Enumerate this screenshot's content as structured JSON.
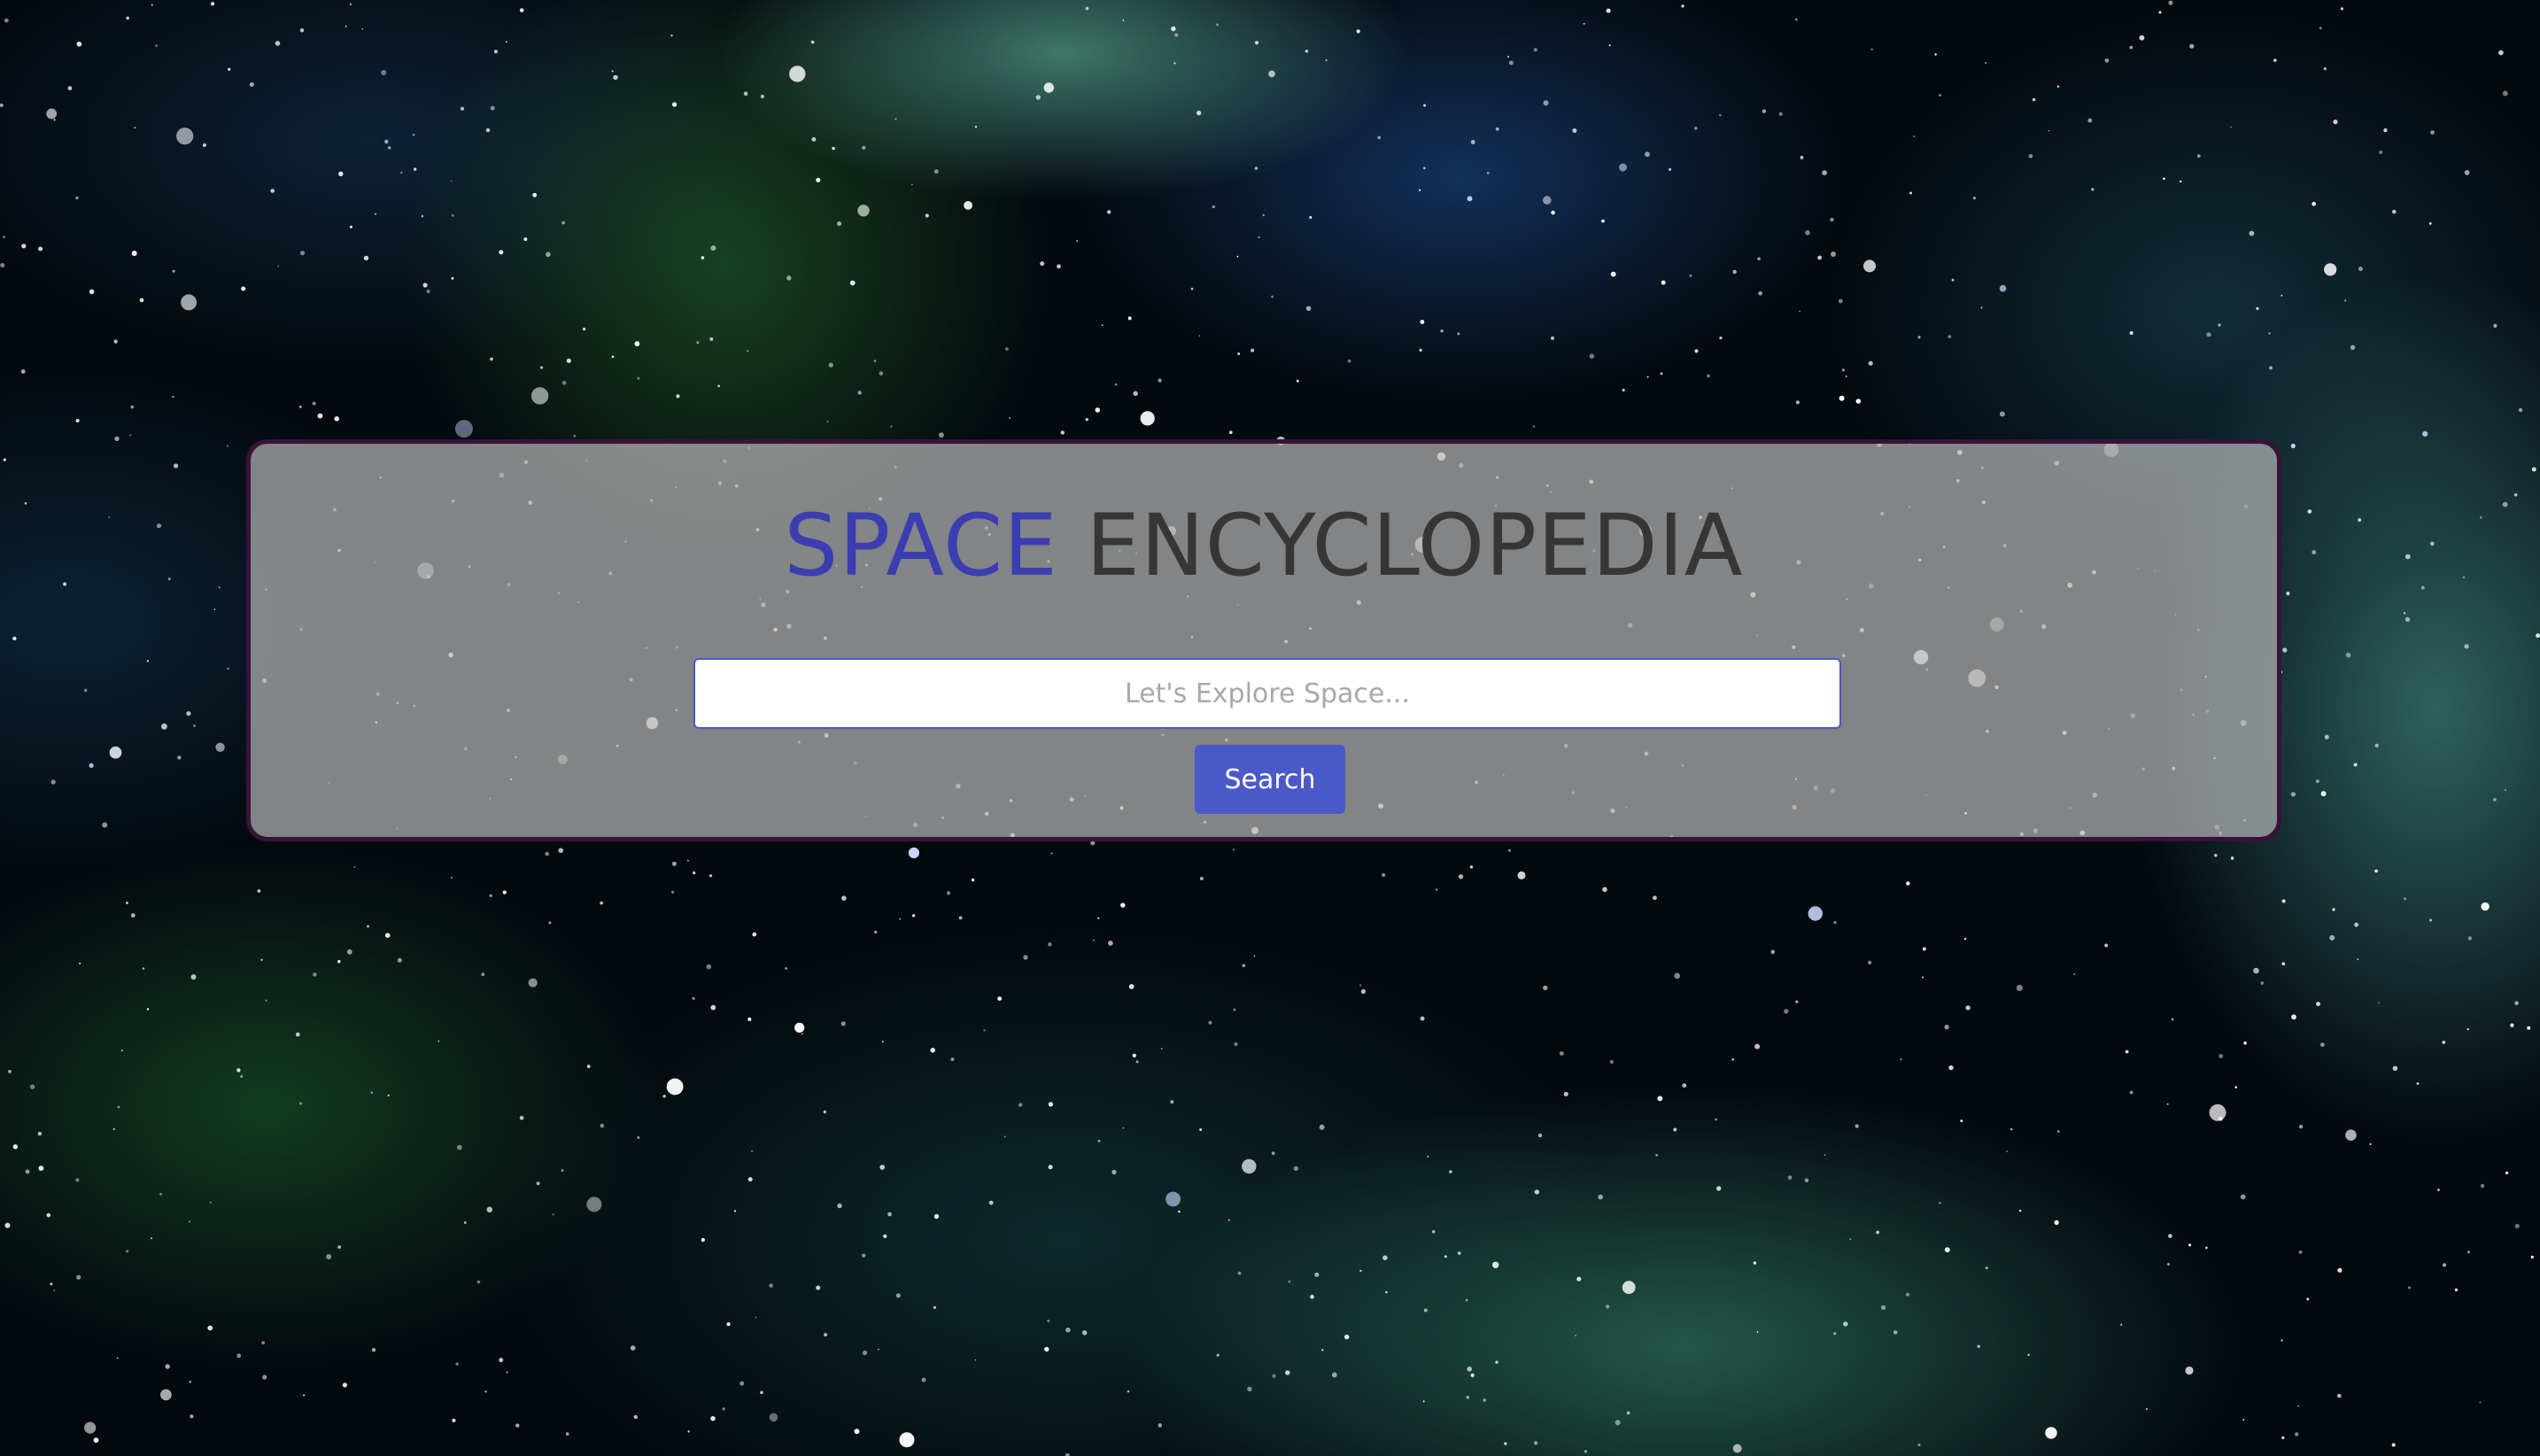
{
  "header": {
    "title_part1": "SPACE",
    "title_part2": "ENCYCLOPEDIA"
  },
  "search": {
    "placeholder": "Let's Explore Space...",
    "value": "",
    "button_label": "Search"
  },
  "colors": {
    "title_accent": "#3a3eb0",
    "title_main": "#363636",
    "button": "#4b59c8",
    "panel_border": "#3a1238"
  }
}
